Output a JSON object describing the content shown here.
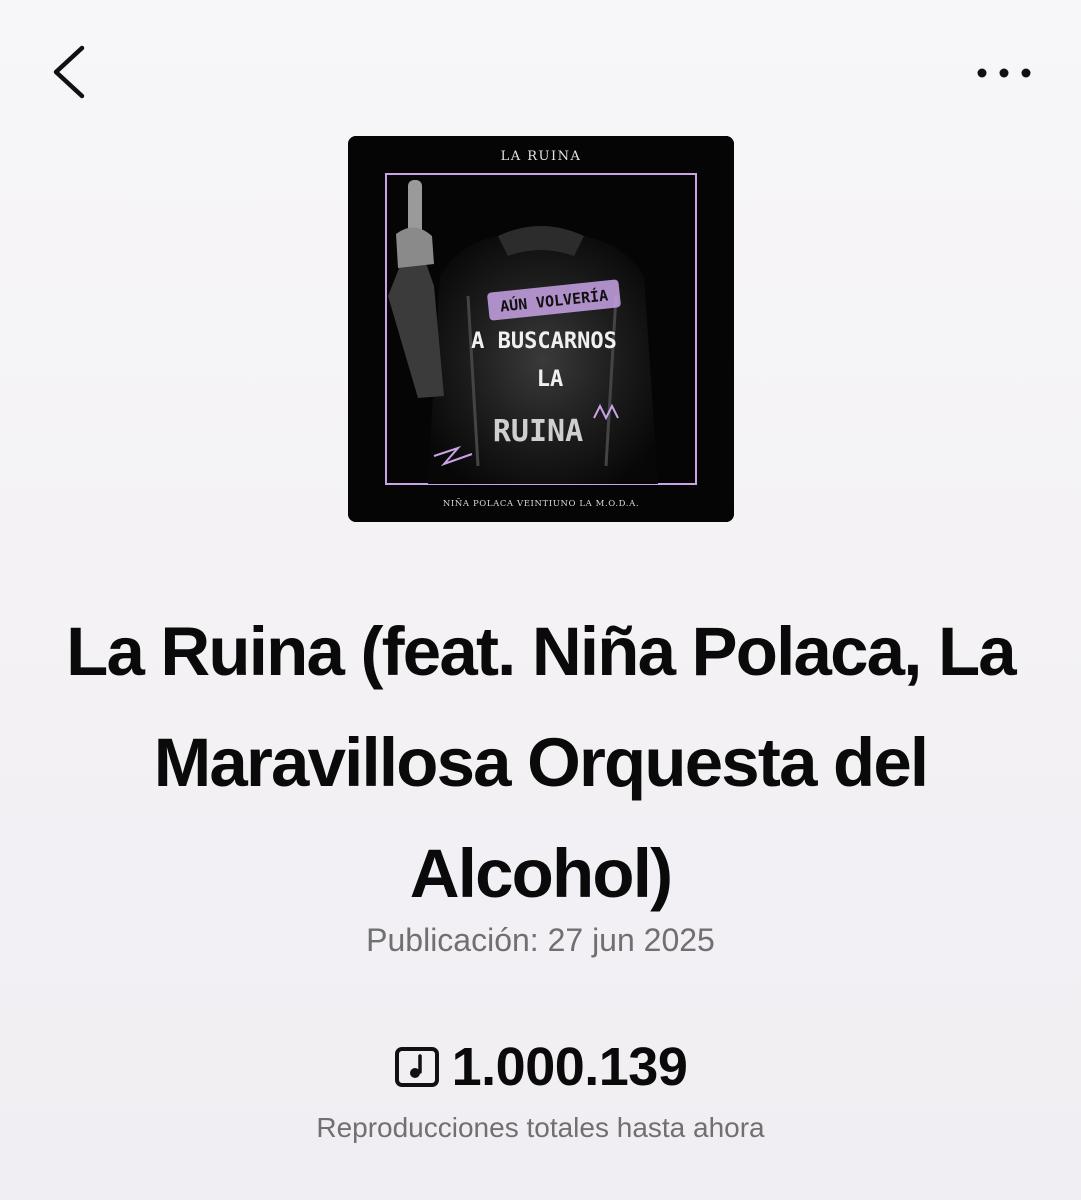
{
  "nav": {
    "back_icon": "chevron-left-icon",
    "more_icon": "ellipsis-horizontal-icon"
  },
  "cover": {
    "top_text": "LA RUINA",
    "line1": "AÚN VOLVERÍA",
    "line2": "A BUSCARNOS",
    "line3": "LA",
    "line4": "RUINA",
    "bottom_text": "NIÑA POLACA VEINTIUNO LA M.O.D.A.",
    "accent_color": "#c9a3e6"
  },
  "track": {
    "title": "La Ruina (feat. Niña Polaca, La Maravillosa Orquesta del Alcohol)",
    "release": "Publicación: 27 jun 2025"
  },
  "stats": {
    "icon": "music-note-box-icon",
    "plays": "1.000.139",
    "caption": "Reproducciones totales hasta ahora"
  }
}
